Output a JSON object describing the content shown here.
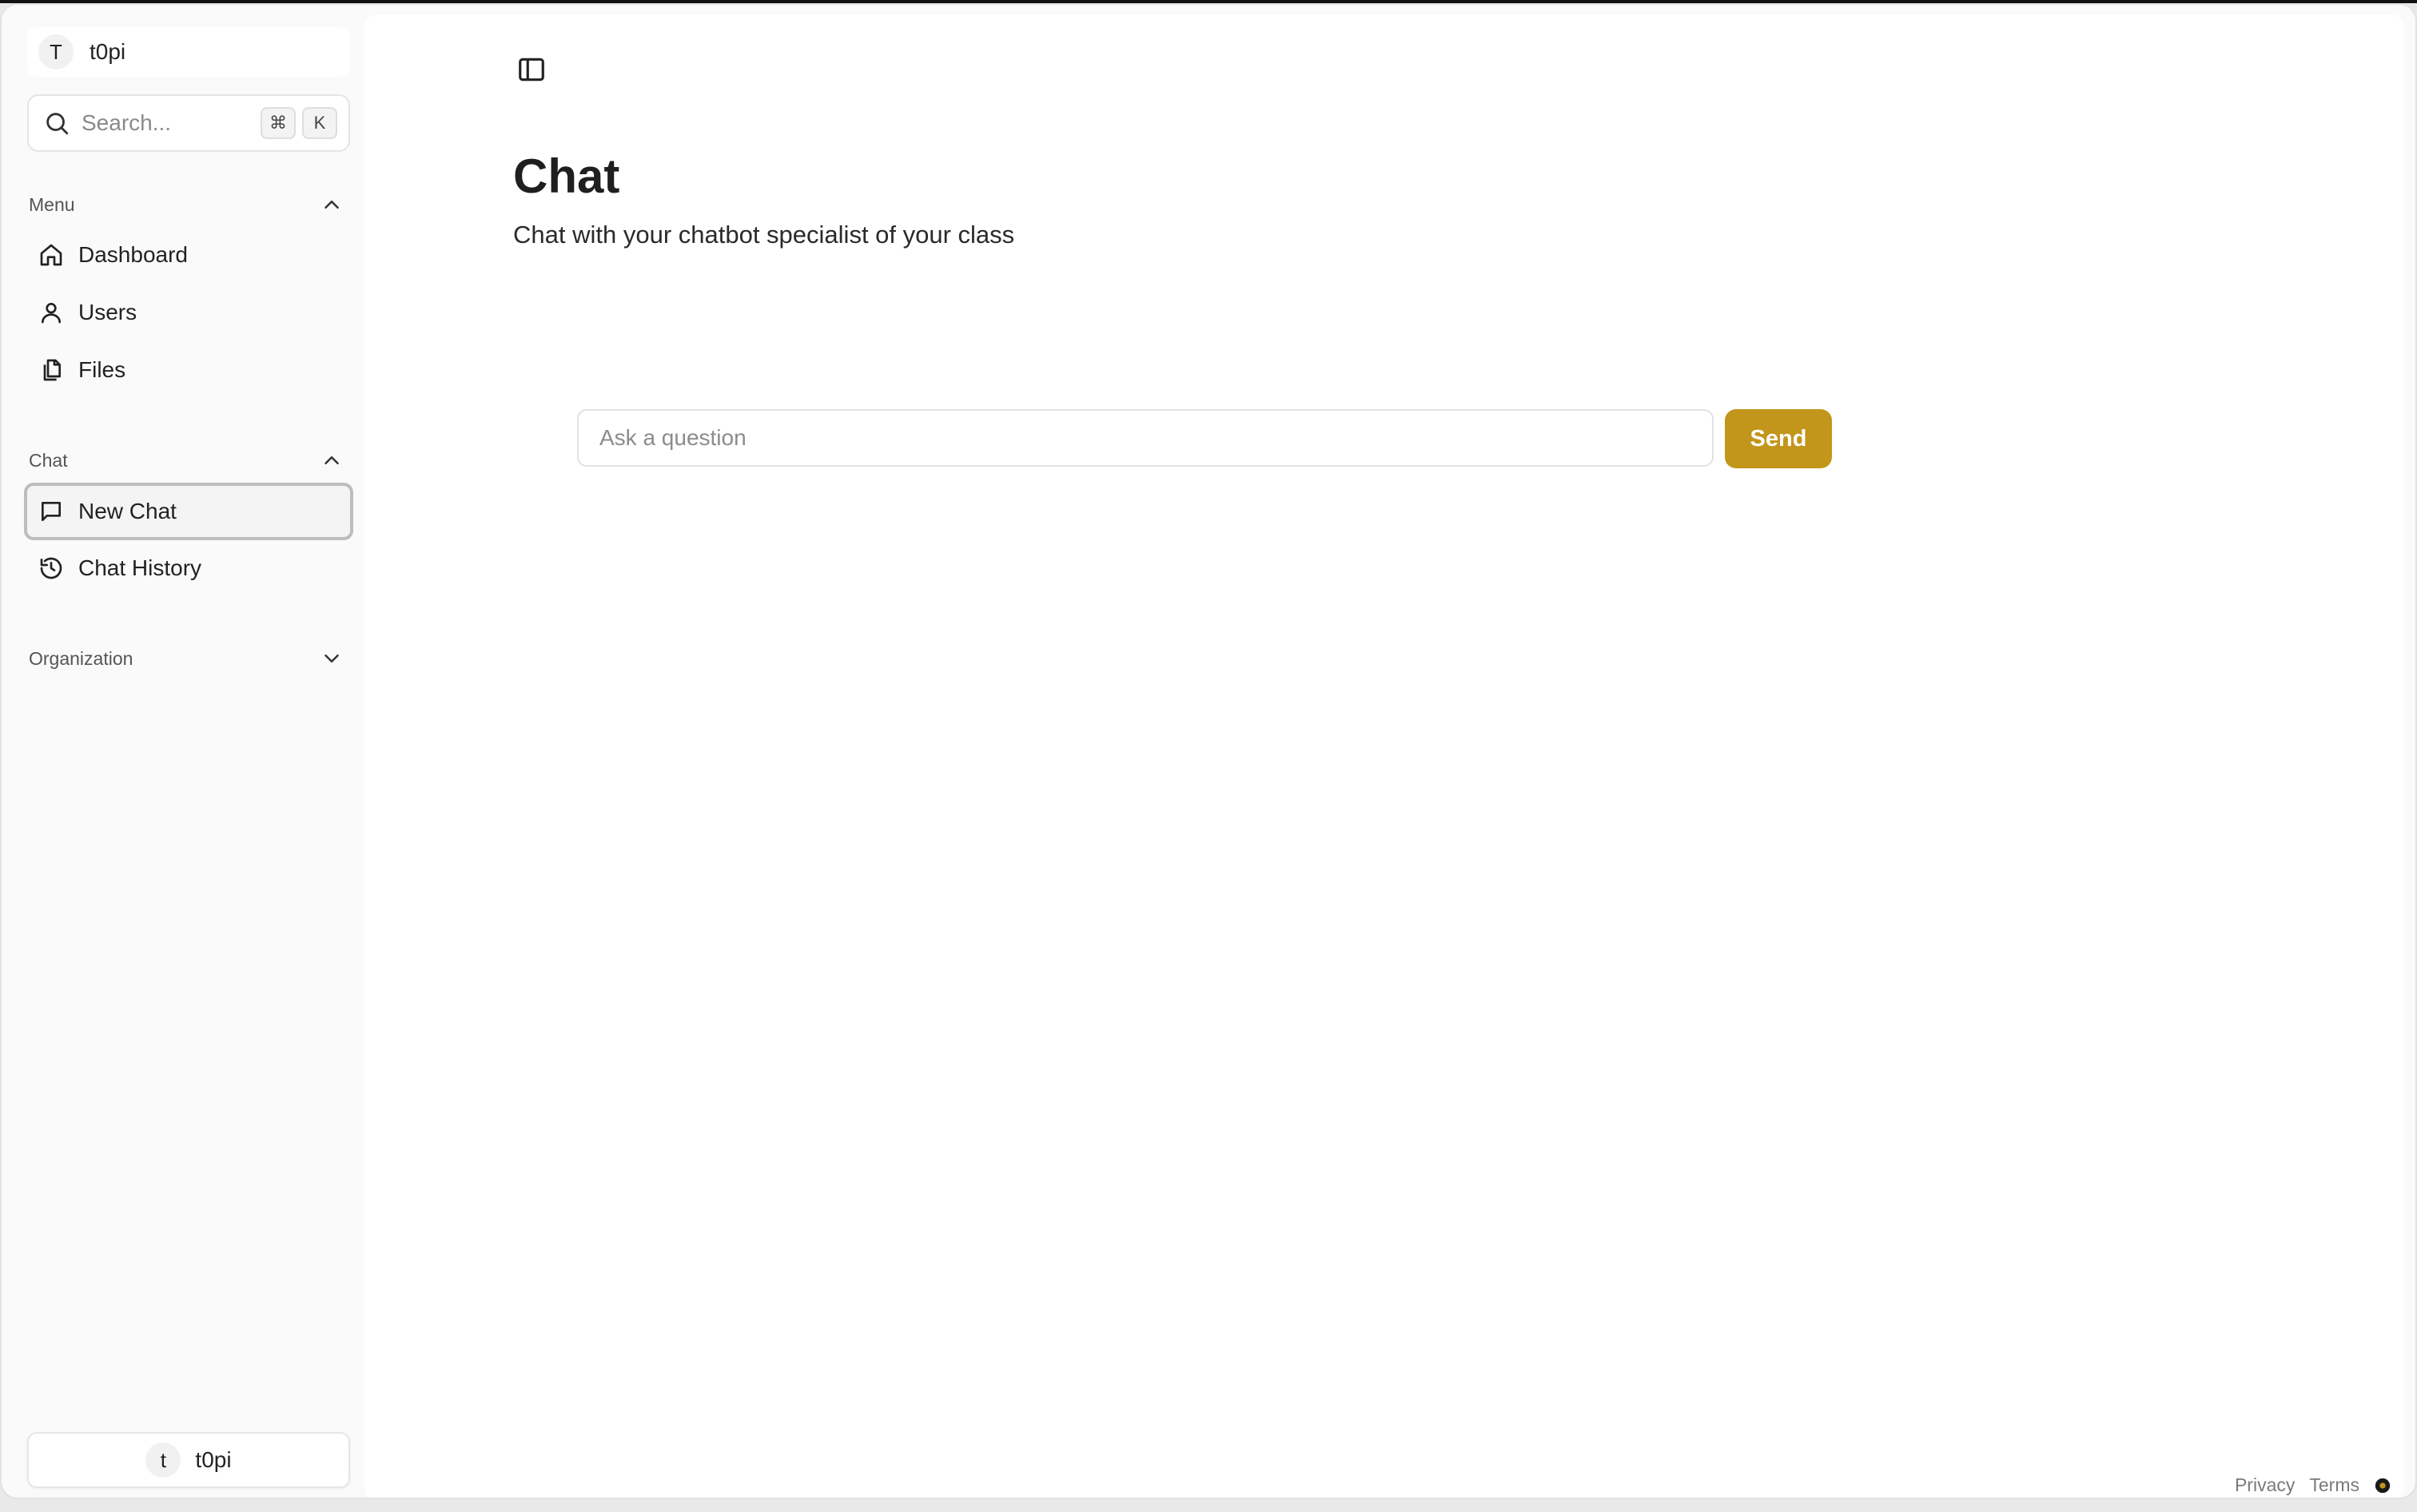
{
  "workspace": {
    "initial": "T",
    "name": "t0pi"
  },
  "search": {
    "placeholder": "Search...",
    "shortcut_cmd": "⌘",
    "shortcut_key": "K"
  },
  "sidebar": {
    "menu": {
      "title": "Menu",
      "items": [
        {
          "label": "Dashboard",
          "icon": "home-icon"
        },
        {
          "label": "Users",
          "icon": "user-icon"
        },
        {
          "label": "Files",
          "icon": "files-icon"
        }
      ]
    },
    "chat": {
      "title": "Chat",
      "items": [
        {
          "label": "New Chat",
          "icon": "message-square-icon",
          "active": true
        },
        {
          "label": "Chat History",
          "icon": "history-icon"
        }
      ]
    },
    "organization": {
      "title": "Organization"
    }
  },
  "user": {
    "initial": "t",
    "name": "t0pi"
  },
  "main": {
    "title": "Chat",
    "subtitle": "Chat with your chatbot specialist of your class",
    "input_placeholder": "Ask a question",
    "send_label": "Send"
  },
  "footer": {
    "privacy": "Privacy",
    "terms": "Terms"
  },
  "colors": {
    "accent": "#c2961b",
    "active_border": "#bdbdbd"
  }
}
